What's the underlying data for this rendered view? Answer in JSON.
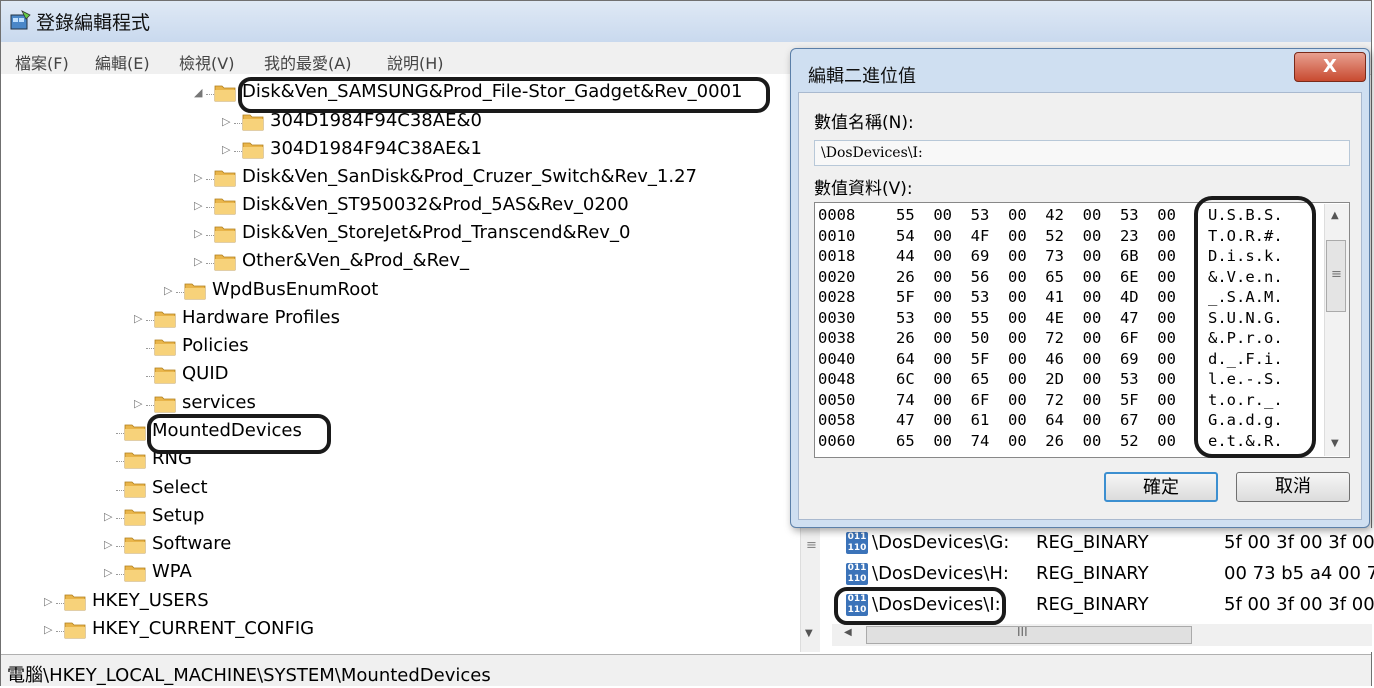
{
  "window": {
    "title": "登錄編輯程式"
  },
  "menu": [
    "檔案(F)",
    "編輯(E)",
    "檢視(V)",
    "我的最愛(A)",
    "說明(H)"
  ],
  "tree": {
    "nodes": [
      {
        "label": "Disk&Ven_SAMSUNG&Prod_File-Stor_Gadget&Rev_0001",
        "expander": "◢"
      },
      {
        "label": "304D1984F94C38AE&0",
        "expander": "▷"
      },
      {
        "label": "304D1984F94C38AE&1",
        "expander": "▷"
      },
      {
        "label": "Disk&Ven_SanDisk&Prod_Cruzer_Switch&Rev_1.27",
        "expander": "▷"
      },
      {
        "label": "Disk&Ven_ST950032&Prod_5AS&Rev_0200",
        "expander": "▷"
      },
      {
        "label": "Disk&Ven_StoreJet&Prod_Transcend&Rev_0",
        "expander": "▷"
      },
      {
        "label": "Other&Ven_&Prod_&Rev_",
        "expander": "▷"
      },
      {
        "label": "WpdBusEnumRoot",
        "expander": "▷"
      },
      {
        "label": "Hardware Profiles",
        "expander": "▷"
      },
      {
        "label": "Policies",
        "expander": ""
      },
      {
        "label": "QUID",
        "expander": ""
      },
      {
        "label": "services",
        "expander": "▷"
      },
      {
        "label": "MountedDevices",
        "expander": ""
      },
      {
        "label": "RNG",
        "expander": ""
      },
      {
        "label": "Select",
        "expander": ""
      },
      {
        "label": "Setup",
        "expander": "▷"
      },
      {
        "label": "Software",
        "expander": "▷"
      },
      {
        "label": "WPA",
        "expander": "▷"
      },
      {
        "label": "HKEY_USERS",
        "expander": "▷"
      },
      {
        "label": "HKEY_CURRENT_CONFIG",
        "expander": "▷"
      }
    ]
  },
  "list": {
    "rows": [
      {
        "name": "\\DosDevices\\G:",
        "type": "REG_BINARY",
        "data": "5f 00 3f 00 3f 00"
      },
      {
        "name": "\\DosDevices\\H:",
        "type": "REG_BINARY",
        "data": "00 73 b5 a4 00 7"
      },
      {
        "name": "\\DosDevices\\I:",
        "type": "REG_BINARY",
        "data": "5f 00 3f 00 3f 00"
      }
    ],
    "hscroll_mark": "III"
  },
  "status": {
    "path": "電腦\\HKEY_LOCAL_MACHINE\\SYSTEM\\MountedDevices"
  },
  "dialog": {
    "title": "編輯二進位值",
    "close_label": "X",
    "value_name_label": "數值名稱(N):",
    "value_name": "\\DosDevices\\I:",
    "value_data_label": "數值資料(V):",
    "hex_rows": [
      {
        "offset": "0008",
        "bytes": "55  00  53  00  42  00  53  00",
        "ascii": "U.S.B.S."
      },
      {
        "offset": "0010",
        "bytes": "54  00  4F  00  52  00  23  00",
        "ascii": "T.O.R.#."
      },
      {
        "offset": "0018",
        "bytes": "44  00  69  00  73  00  6B  00",
        "ascii": "D.i.s.k."
      },
      {
        "offset": "0020",
        "bytes": "26  00  56  00  65  00  6E  00",
        "ascii": "&.V.e.n."
      },
      {
        "offset": "0028",
        "bytes": "5F  00  53  00  41  00  4D  00",
        "ascii": "_.S.A.M."
      },
      {
        "offset": "0030",
        "bytes": "53  00  55  00  4E  00  47  00",
        "ascii": "S.U.N.G."
      },
      {
        "offset": "0038",
        "bytes": "26  00  50  00  72  00  6F  00",
        "ascii": "&.P.r.o."
      },
      {
        "offset": "0040",
        "bytes": "64  00  5F  00  46  00  69  00",
        "ascii": "d._.F.i."
      },
      {
        "offset": "0048",
        "bytes": "6C  00  65  00  2D  00  53  00",
        "ascii": "l.e.-.S."
      },
      {
        "offset": "0050",
        "bytes": "74  00  6F  00  72  00  5F  00",
        "ascii": "t.o.r._."
      },
      {
        "offset": "0058",
        "bytes": "47  00  61  00  64  00  67  00",
        "ascii": "G.a.d.g."
      },
      {
        "offset": "0060",
        "bytes": "65  00  74  00  26  00  52  00",
        "ascii": "e.t.&.R."
      }
    ],
    "ok_label": "確定",
    "cancel_label": "取消"
  }
}
